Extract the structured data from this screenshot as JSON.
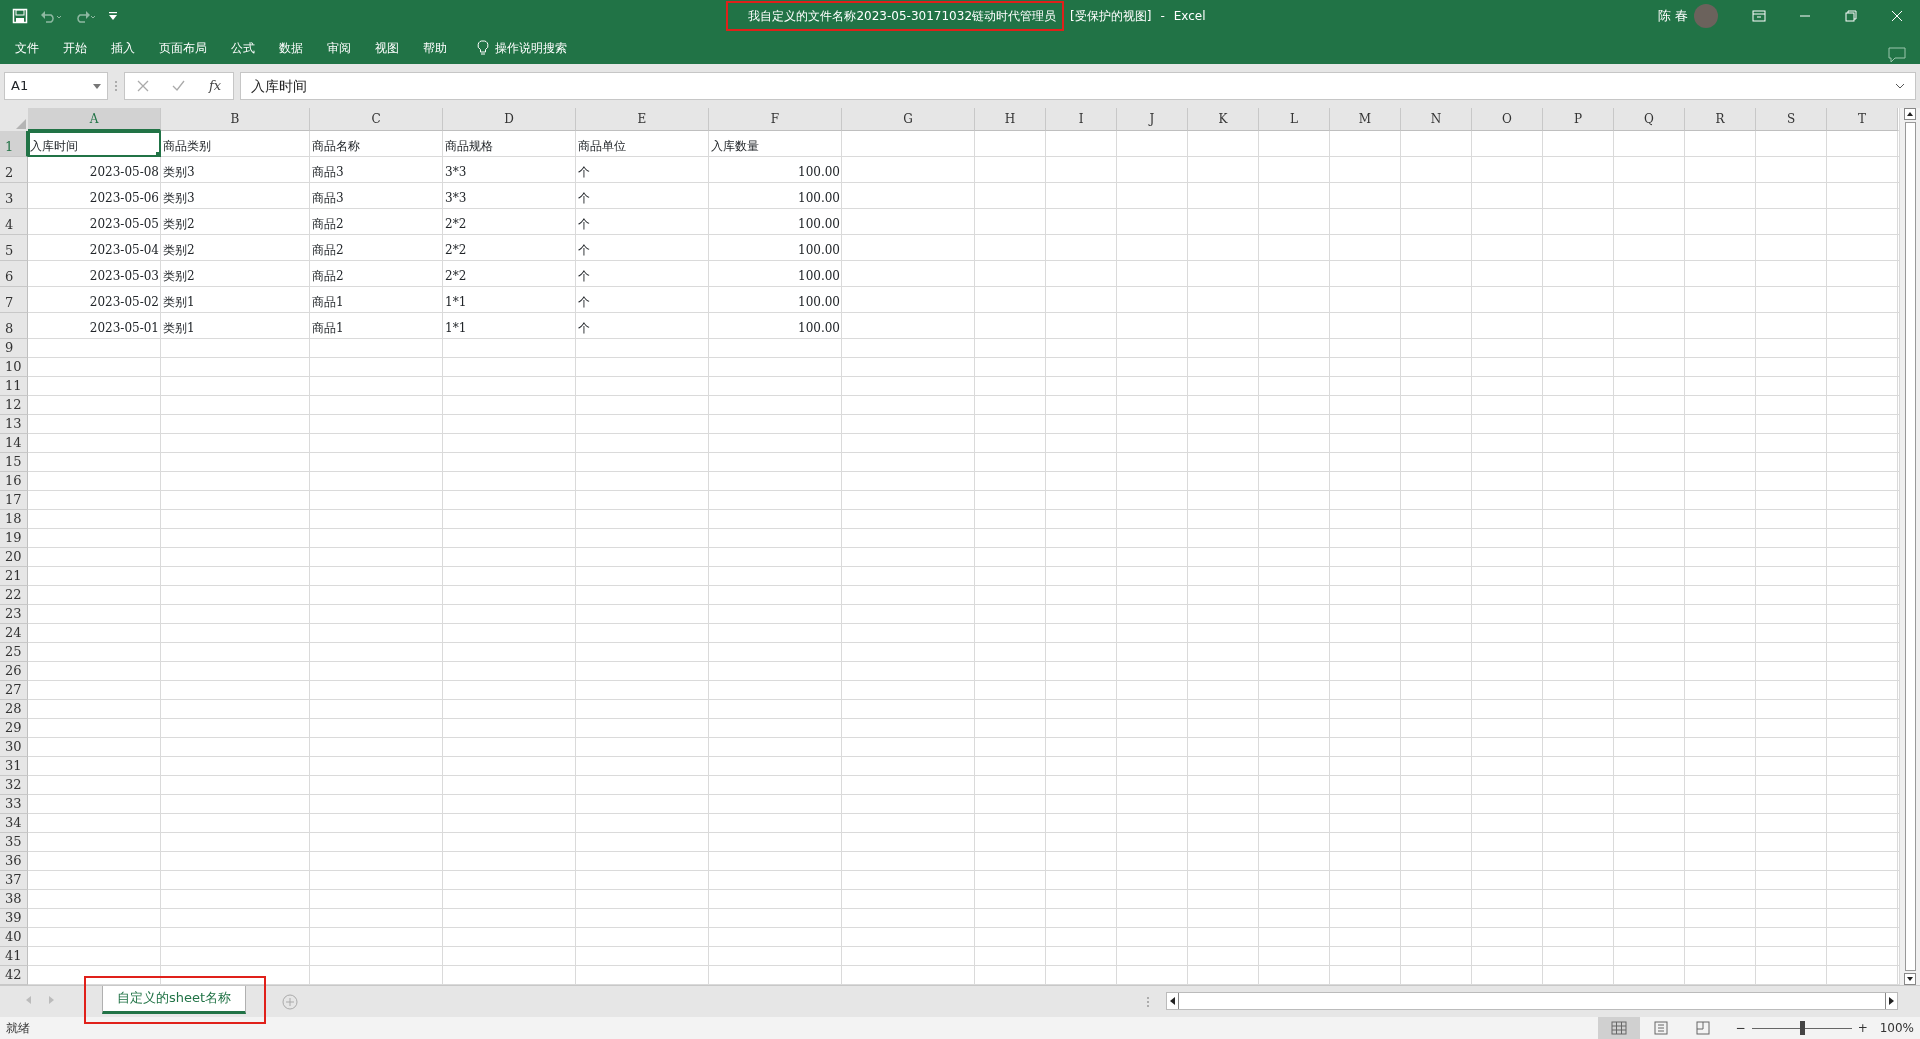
{
  "title_bar": {
    "title": "我自定义的文件名称2023-05-30171032链动时代管理员",
    "highlighted": true,
    "mode": "[受保护的视图]",
    "separator": "-",
    "app": "Excel",
    "user": "陈 春"
  },
  "menu": [
    {
      "label": "文件"
    },
    {
      "label": "开始"
    },
    {
      "label": "插入"
    },
    {
      "label": "页面布局"
    },
    {
      "label": "公式"
    },
    {
      "label": "数据"
    },
    {
      "label": "审阅"
    },
    {
      "label": "视图"
    },
    {
      "label": "帮助"
    }
  ],
  "tell_me": {
    "label": "操作说明搜索"
  },
  "formula_bar": {
    "name_box": "A1",
    "fx": "fx",
    "value": "入库时间"
  },
  "columns": [
    {
      "label": "A",
      "selected": true
    },
    {
      "label": "B",
      "selected": false
    },
    {
      "label": "C",
      "selected": false
    },
    {
      "label": "D",
      "selected": false
    },
    {
      "label": "E",
      "selected": false
    },
    {
      "label": "F",
      "selected": false
    },
    {
      "label": "G",
      "selected": false
    },
    {
      "label": "H",
      "selected": false
    },
    {
      "label": "I",
      "selected": false
    },
    {
      "label": "J",
      "selected": false
    },
    {
      "label": "K",
      "selected": false
    },
    {
      "label": "L",
      "selected": false
    },
    {
      "label": "M",
      "selected": false
    },
    {
      "label": "N",
      "selected": false
    },
    {
      "label": "O",
      "selected": false
    },
    {
      "label": "P",
      "selected": false
    },
    {
      "label": "Q",
      "selected": false
    },
    {
      "label": "R",
      "selected": false
    },
    {
      "label": "S",
      "selected": false
    },
    {
      "label": "T",
      "selected": false
    }
  ],
  "rows": [
    {
      "label": "1",
      "selected": true,
      "kind": "header",
      "cells": [
        {
          "text": "入库时间",
          "kind": "text"
        },
        {
          "text": "商品类别",
          "kind": "text"
        },
        {
          "text": "商品名称",
          "kind": "text"
        },
        {
          "text": "商品规格",
          "kind": "text"
        },
        {
          "text": "商品单位",
          "kind": "text"
        },
        {
          "text": "入库数量",
          "kind": "text"
        }
      ]
    },
    {
      "label": "2",
      "selected": false,
      "kind": "data",
      "cells": [
        {
          "text": "2023-05-08",
          "kind": "number"
        },
        {
          "text": "类别3",
          "kind": "text"
        },
        {
          "text": "商品3",
          "kind": "text"
        },
        {
          "text": "3*3",
          "kind": "text"
        },
        {
          "text": "个",
          "kind": "text"
        },
        {
          "text": "100.00",
          "kind": "number"
        }
      ]
    },
    {
      "label": "3",
      "selected": false,
      "kind": "data",
      "cells": [
        {
          "text": "2023-05-06",
          "kind": "number"
        },
        {
          "text": "类别3",
          "kind": "text"
        },
        {
          "text": "商品3",
          "kind": "text"
        },
        {
          "text": "3*3",
          "kind": "text"
        },
        {
          "text": "个",
          "kind": "text"
        },
        {
          "text": "100.00",
          "kind": "number"
        }
      ]
    },
    {
      "label": "4",
      "selected": false,
      "kind": "data",
      "cells": [
        {
          "text": "2023-05-05",
          "kind": "number"
        },
        {
          "text": "类别2",
          "kind": "text"
        },
        {
          "text": "商品2",
          "kind": "text"
        },
        {
          "text": "2*2",
          "kind": "text"
        },
        {
          "text": "个",
          "kind": "text"
        },
        {
          "text": "100.00",
          "kind": "number"
        }
      ]
    },
    {
      "label": "5",
      "selected": false,
      "kind": "data",
      "cells": [
        {
          "text": "2023-05-04",
          "kind": "number"
        },
        {
          "text": "类别2",
          "kind": "text"
        },
        {
          "text": "商品2",
          "kind": "text"
        },
        {
          "text": "2*2",
          "kind": "text"
        },
        {
          "text": "个",
          "kind": "text"
        },
        {
          "text": "100.00",
          "kind": "number"
        }
      ]
    },
    {
      "label": "6",
      "selected": false,
      "kind": "data",
      "cells": [
        {
          "text": "2023-05-03",
          "kind": "number"
        },
        {
          "text": "类别2",
          "kind": "text"
        },
        {
          "text": "商品2",
          "kind": "text"
        },
        {
          "text": "2*2",
          "kind": "text"
        },
        {
          "text": "个",
          "kind": "text"
        },
        {
          "text": "100.00",
          "kind": "number"
        }
      ]
    },
    {
      "label": "7",
      "selected": false,
      "kind": "data",
      "cells": [
        {
          "text": "2023-05-02",
          "kind": "number"
        },
        {
          "text": "类别1",
          "kind": "text"
        },
        {
          "text": "商品1",
          "kind": "text"
        },
        {
          "text": "1*1",
          "kind": "text"
        },
        {
          "text": "个",
          "kind": "text"
        },
        {
          "text": "100.00",
          "kind": "number"
        }
      ]
    },
    {
      "label": "8",
      "selected": false,
      "kind": "data",
      "cells": [
        {
          "text": "2023-05-01",
          "kind": "number"
        },
        {
          "text": "类别1",
          "kind": "text"
        },
        {
          "text": "商品1",
          "kind": "text"
        },
        {
          "text": "1*1",
          "kind": "text"
        },
        {
          "text": "个",
          "kind": "text"
        },
        {
          "text": "100.00",
          "kind": "number"
        }
      ]
    },
    {
      "label": "9",
      "selected": false,
      "kind": "blank"
    },
    {
      "label": "10",
      "selected": false,
      "kind": "blank"
    },
    {
      "label": "11",
      "selected": false,
      "kind": "blank"
    },
    {
      "label": "12",
      "selected": false,
      "kind": "blank"
    },
    {
      "label": "13",
      "selected": false,
      "kind": "blank"
    },
    {
      "label": "14",
      "selected": false,
      "kind": "blank"
    },
    {
      "label": "15",
      "selected": false,
      "kind": "blank"
    },
    {
      "label": "16",
      "selected": false,
      "kind": "blank"
    },
    {
      "label": "17",
      "selected": false,
      "kind": "blank"
    },
    {
      "label": "18",
      "selected": false,
      "kind": "blank"
    },
    {
      "label": "19",
      "selected": false,
      "kind": "blank"
    },
    {
      "label": "20",
      "selected": false,
      "kind": "blank"
    },
    {
      "label": "21",
      "selected": false,
      "kind": "blank"
    },
    {
      "label": "22",
      "selected": false,
      "kind": "blank"
    },
    {
      "label": "23",
      "selected": false,
      "kind": "blank"
    },
    {
      "label": "24",
      "selected": false,
      "kind": "blank"
    },
    {
      "label": "25",
      "selected": false,
      "kind": "blank"
    },
    {
      "label": "26",
      "selected": false,
      "kind": "blank"
    },
    {
      "label": "27",
      "selected": false,
      "kind": "blank"
    },
    {
      "label": "28",
      "selected": false,
      "kind": "blank"
    },
    {
      "label": "29",
      "selected": false,
      "kind": "blank"
    },
    {
      "label": "30",
      "selected": false,
      "kind": "blank"
    },
    {
      "label": "31",
      "selected": false,
      "kind": "blank"
    },
    {
      "label": "32",
      "selected": false,
      "kind": "blank"
    },
    {
      "label": "33",
      "selected": false,
      "kind": "blank"
    },
    {
      "label": "34",
      "selected": false,
      "kind": "blank"
    },
    {
      "label": "35",
      "selected": false,
      "kind": "blank"
    },
    {
      "label": "36",
      "selected": false,
      "kind": "blank"
    },
    {
      "label": "37",
      "selected": false,
      "kind": "blank"
    },
    {
      "label": "38",
      "selected": false,
      "kind": "blank"
    },
    {
      "label": "39",
      "selected": false,
      "kind": "blank"
    },
    {
      "label": "40",
      "selected": false,
      "kind": "blank"
    },
    {
      "label": "41",
      "selected": false,
      "kind": "blank"
    },
    {
      "label": "42",
      "selected": false,
      "kind": "blank"
    }
  ],
  "sheet_tabs": [
    {
      "label": "自定义的sheet名称",
      "selected": true,
      "highlighted": true
    }
  ],
  "status_bar": {
    "text": "就绪",
    "views": [
      {
        "kind": "normal",
        "selected": true
      },
      {
        "kind": "page-layout",
        "selected": false
      },
      {
        "kind": "page-break",
        "selected": false
      }
    ],
    "zoom_minus": "−",
    "zoom_plus": "+",
    "zoom_level": {
      "level": 0.5
    },
    "zoom_reading": "100%"
  }
}
